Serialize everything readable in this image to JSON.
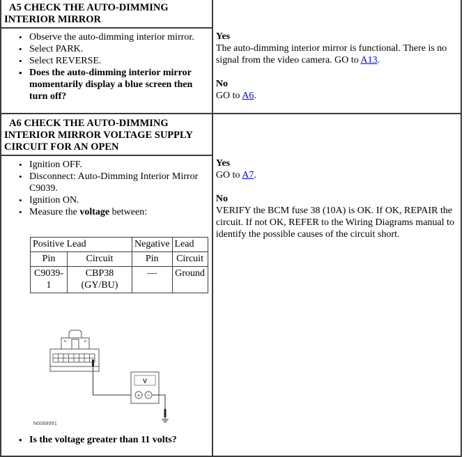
{
  "steps": [
    {
      "id": "A5",
      "header": "A5 CHECK THE AUTO-DIMMING INTERIOR MIRROR",
      "header_lines": [
        "A5 CHECK THE AUTO-DIMMING",
        "INTERIOR MIRROR"
      ],
      "actions": [
        "Observe the auto-dimming interior mirror.",
        "Select PARK.",
        "Select REVERSE."
      ],
      "question": "Does the auto-dimming interior mirror momentarily display a blue screen then turn off?",
      "yes": {
        "label": "Yes",
        "text": "The auto-dimming interior mirror is functional. There is no signal from the video camera. GO to ",
        "link": "A13",
        "suffix": "."
      },
      "no": {
        "label": "No",
        "text": "GO to ",
        "link": "A6",
        "suffix": "."
      }
    },
    {
      "id": "A6",
      "header": "A6 CHECK THE AUTO-DIMMING INTERIOR MIRROR VOLTAGE SUPPLY CIRCUIT FOR AN OPEN",
      "header_lines": [
        "A6 CHECK THE AUTO-DIMMING",
        "INTERIOR MIRROR VOLTAGE SUPPLY",
        "CIRCUIT FOR AN OPEN"
      ],
      "actions": [
        "Ignition OFF.",
        "Disconnect: Auto-Dimming Interior Mirror C9039.",
        "Ignition ON."
      ],
      "measure_prefix": "Measure the ",
      "measure_bold": "voltage",
      "measure_suffix": " between:",
      "measurement_table": {
        "group_headers": [
          "Positive",
          "Lead",
          "Negative",
          "Lead"
        ],
        "columns": [
          "Pin",
          "Circuit",
          "Pin",
          "Circuit"
        ],
        "rows": [
          [
            "C9039-1",
            "CBP38 (GY/BU)",
            "—",
            "Ground"
          ]
        ],
        "row_display": [
          [
            "C9039-",
            "1"
          ],
          [
            "CBP38",
            "(GY/BU)"
          ]
        ]
      },
      "figure": {
        "id": "N0068991",
        "meter_label": "V",
        "plus": "+",
        "minus": "−"
      },
      "question": "Is the voltage greater than 11 volts?",
      "yes": {
        "label": "Yes",
        "text": "GO to ",
        "link": "A7",
        "suffix": "."
      },
      "no": {
        "label": "No",
        "text": "VERIFY the BCM fuse 38 (10A) is OK. If OK, REPAIR the circuit. If not OK, REFER to the Wiring Diagrams manual to identify the possible causes of the circuit short."
      }
    }
  ]
}
